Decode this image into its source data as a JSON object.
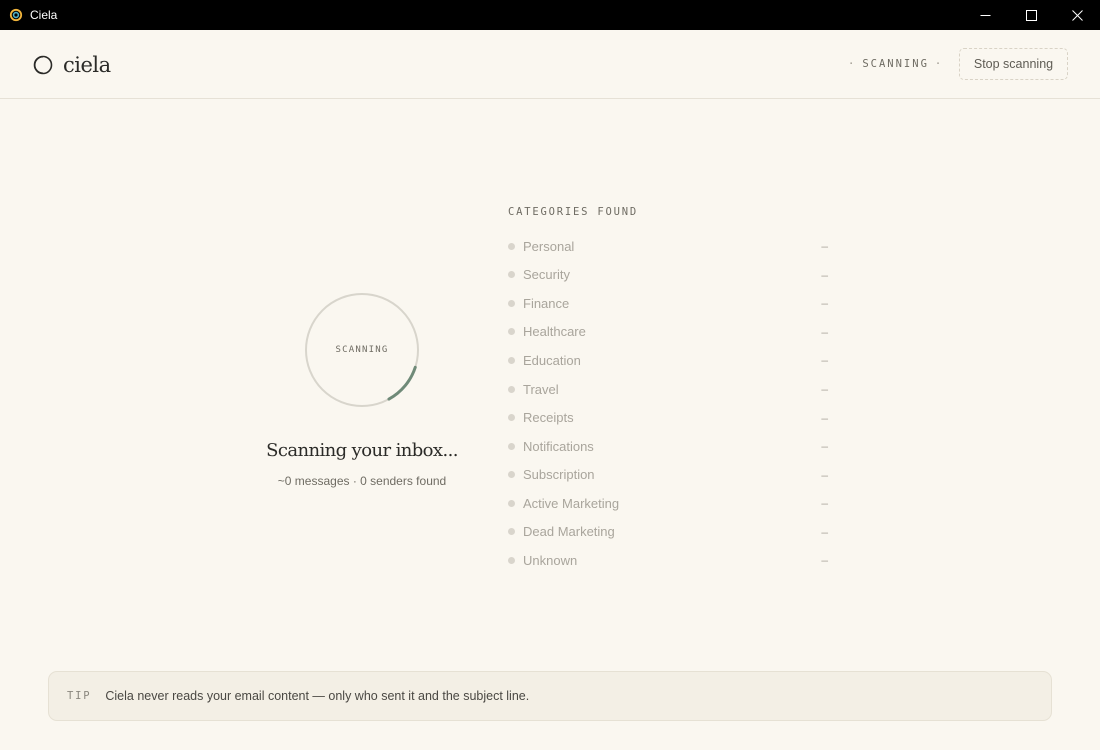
{
  "window": {
    "title": "Ciela"
  },
  "header": {
    "brand": "ciela",
    "status": "SCANNING",
    "stop_button": "Stop scanning"
  },
  "scanner": {
    "ring_label": "SCANNING",
    "progress": 0.12,
    "title": "Scanning your inbox...",
    "subtitle": "~0 messages · 0 senders found"
  },
  "categories": {
    "heading": "CATEGORIES FOUND",
    "items": [
      {
        "label": "Personal",
        "count": "–"
      },
      {
        "label": "Security",
        "count": "–"
      },
      {
        "label": "Finance",
        "count": "–"
      },
      {
        "label": "Healthcare",
        "count": "–"
      },
      {
        "label": "Education",
        "count": "–"
      },
      {
        "label": "Travel",
        "count": "–"
      },
      {
        "label": "Receipts",
        "count": "–"
      },
      {
        "label": "Notifications",
        "count": "–"
      },
      {
        "label": "Subscription",
        "count": "–"
      },
      {
        "label": "Active Marketing",
        "count": "–"
      },
      {
        "label": "Dead Marketing",
        "count": "–"
      },
      {
        "label": "Unknown",
        "count": "–"
      }
    ]
  },
  "tip": {
    "label": "TIP",
    "text": "Ciela never reads your email content — only who sent it and the subject line."
  },
  "colors": {
    "background": "#faf7f0",
    "ring_track": "#d8d5cc",
    "ring_progress": "#6f8a78"
  },
  "icons": {
    "app": "ciela-app-icon",
    "logo": "ciela-logo-icon",
    "minimize": "minimize-icon",
    "maximize": "maximize-icon",
    "close": "close-icon"
  }
}
